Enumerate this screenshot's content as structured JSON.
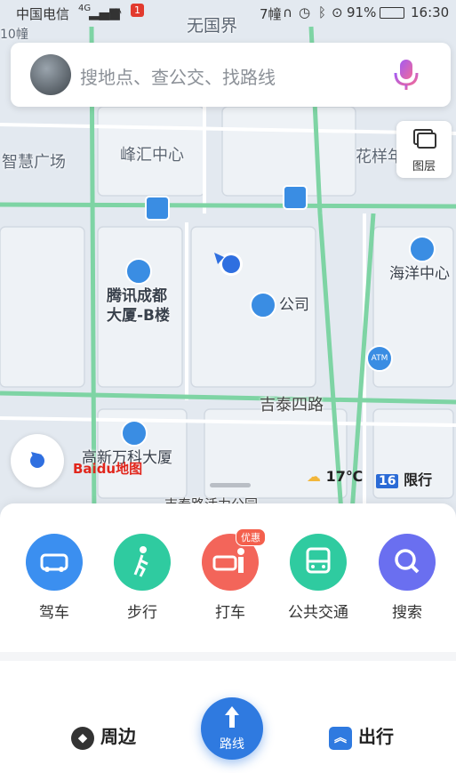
{
  "status_bar": {
    "carrier": "中国电信",
    "signal_text": "4G",
    "alert_badge": "1",
    "center_text": "7幢",
    "battery": "91%",
    "time": "16:30"
  },
  "search": {
    "placeholder": "搜地点、查公交、找路线"
  },
  "map": {
    "labels": {
      "top_center": "无国界",
      "top_left_fragment": "10幢",
      "smart_plaza": "智慧广场",
      "fenghui": "峰汇中心",
      "huayang": "花样年",
      "haiyang": "海洋中心",
      "tencent_line1": "腾讯成都",
      "tencent_line2": "大厦-B楼",
      "company": "公司",
      "jitai_road": "吉泰四路",
      "vanke": "高新万科大厦",
      "bottom_fragment": "吉泰路活力公园"
    },
    "layer_button_label": "图层",
    "atm_label": "ATM",
    "weather": "17℃",
    "traffic_limit_number": "16",
    "traffic_limit_label": "限行",
    "logo_text": "Baidu地图"
  },
  "quick_actions": [
    {
      "label": "驾车",
      "icon": "car-icon",
      "color": "#3b8ff0"
    },
    {
      "label": "步行",
      "icon": "walk-icon",
      "color": "#2fcba0"
    },
    {
      "label": "打车",
      "icon": "taxi-icon",
      "color": "#f3655a",
      "badge": "优惠"
    },
    {
      "label": "公共交通",
      "icon": "bus-icon",
      "color": "#2fcba0"
    },
    {
      "label": "搜索",
      "icon": "search-icon",
      "color": "#6a6ff0"
    }
  ],
  "bottom_nav": {
    "nearby": "周边",
    "route": "路线",
    "travel": "出行"
  },
  "colors": {
    "road": "#7ed4a4",
    "accent": "#2f7ae0"
  }
}
